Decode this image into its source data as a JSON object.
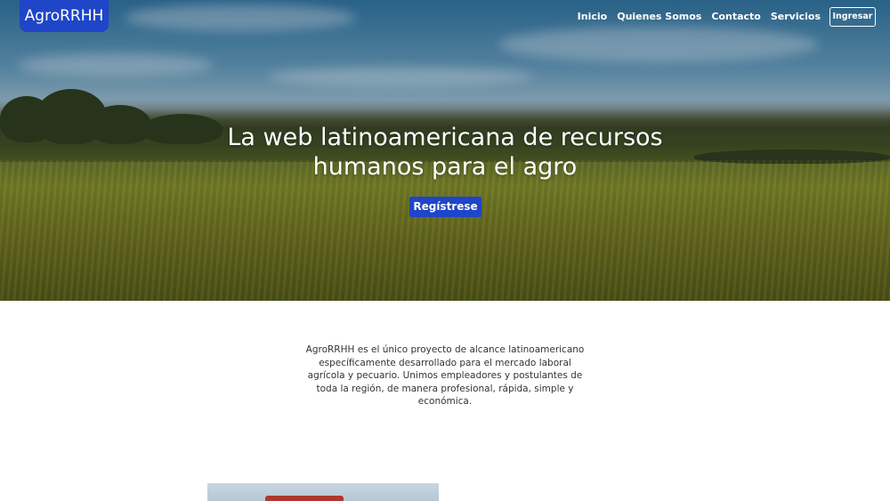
{
  "brand": {
    "name": "AgroRRHH"
  },
  "nav": {
    "items": [
      "Inicio",
      "Quienes Somos",
      "Contacto",
      "Servicios"
    ],
    "login_label": "Ingresar"
  },
  "hero": {
    "title_line1": "La web latinoamericana de recursos",
    "title_line2": "humanos para el agro",
    "cta_label": "Regístrese"
  },
  "about": {
    "text": "AgroRRHH es el único proyecto de alcance latinoamericano específicamente desarrollado para el mercado laboral agrícola y pecuario. Unimos empleadores y postulantes de toda la región, de manera profesional, rápida, simple y económica."
  },
  "colors": {
    "accent": "#1f45c9",
    "text": "#333333"
  }
}
